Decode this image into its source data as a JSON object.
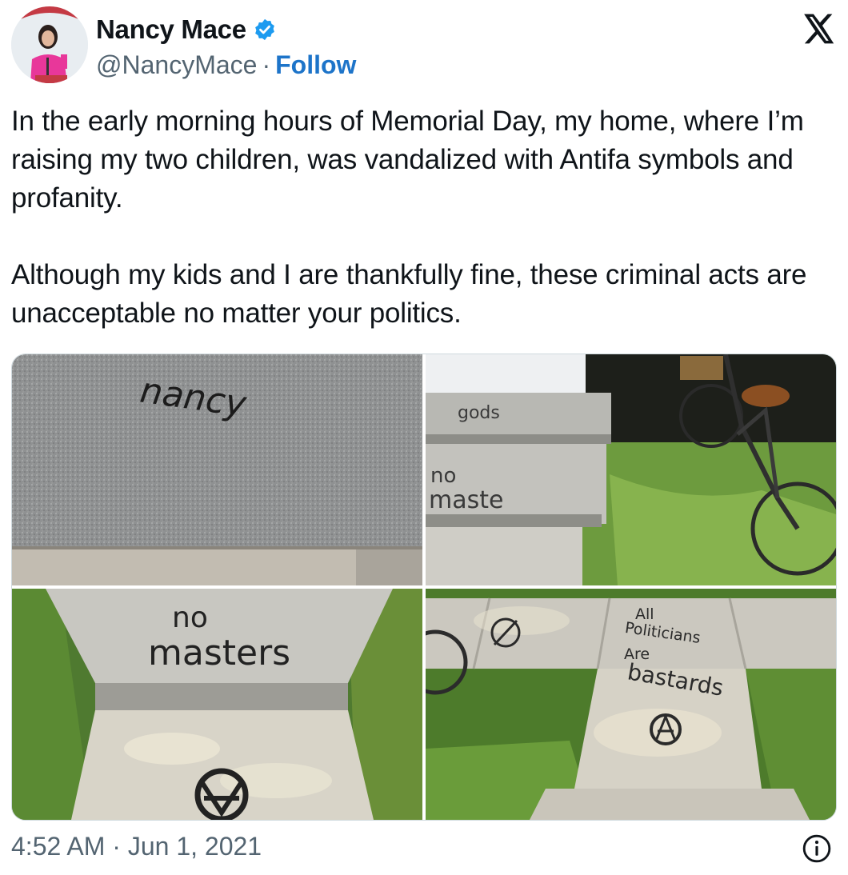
{
  "author": {
    "display_name": "Nancy Mace",
    "handle": "@NancyMace",
    "separator": "·",
    "follow_label": "Follow",
    "verified": true
  },
  "tweet": {
    "paragraphs": [
      "In the early morning hours of Memorial Day, my home, where I’m raising my two children, was vandalized with Antifa symbols and profanity.",
      "Although my kids and I are thankfully fine, these criminal acts are unacceptable no matter your politics."
    ]
  },
  "media": {
    "photo_1_text": "nancy",
    "photo_2_text_top": "gods",
    "photo_2_text_mid": "no",
    "photo_2_text_bottom": "maste",
    "photo_3_text_line1": "no",
    "photo_3_text_line2": "masters",
    "photo_4_text_line1": "All",
    "photo_4_text_line2": "Politicians",
    "photo_4_text_line3": "Are",
    "photo_4_text_line4": "bastards"
  },
  "footer": {
    "timestamp": "4:52 AM · Jun 1, 2021"
  },
  "colors": {
    "follow": "#1d74c9",
    "verified_badge": "#1d9bf0",
    "secondary_text": "#536471",
    "border": "#cfd9de"
  },
  "icons": [
    "verified-badge-icon",
    "x-logo-icon",
    "info-icon"
  ]
}
